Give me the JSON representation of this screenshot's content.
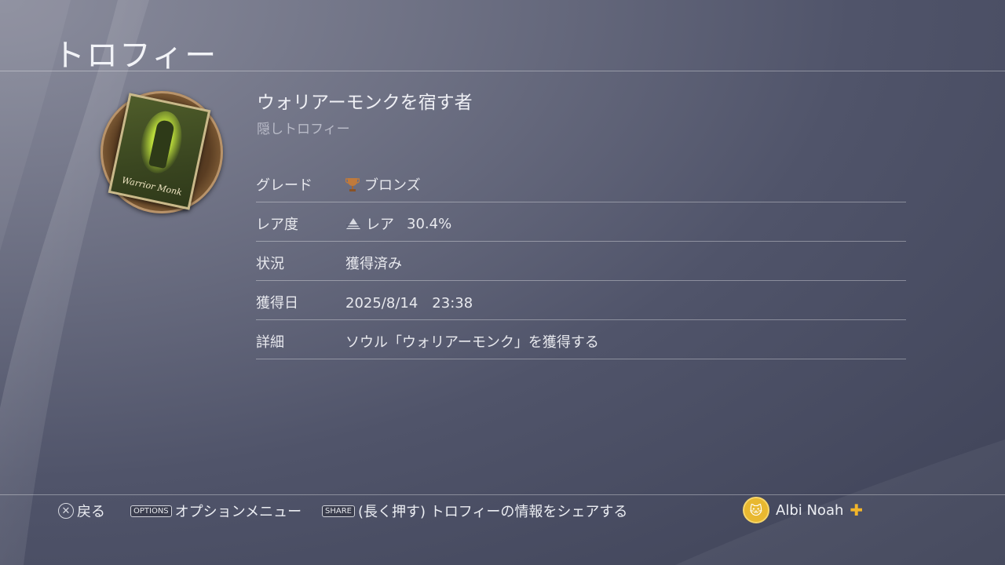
{
  "header": {
    "title": "トロフィー"
  },
  "trophy": {
    "name": "ウォリアーモンクを宿す者",
    "subtitle": "隠しトロフィー",
    "card_text": "Warrior Monk",
    "rows": [
      {
        "label": "グレード",
        "value": "ブロンズ",
        "icon": "bronze-trophy-icon"
      },
      {
        "label": "レア度",
        "value": "レア",
        "percent": "30.4%",
        "icon": "rarity-pyramid-icon"
      },
      {
        "label": "状況",
        "value": "獲得済み"
      },
      {
        "label": "獲得日",
        "value": "2025/8/14　23:38"
      },
      {
        "label": "詳細",
        "value": "ソウル「ウォリアーモンク」を獲得する"
      }
    ]
  },
  "footer": {
    "back_label": "戻る",
    "options_key": "OPTIONS",
    "options_label": "オプションメニュー",
    "share_key": "SHARE",
    "share_label": "(長く押す) トロフィーの情報をシェアする",
    "user_name": "Albi Noah",
    "plus_symbol": "✚"
  },
  "colors": {
    "background": "#50546a",
    "bronze": "#c07a3c",
    "ps_plus": "#f2b62a"
  }
}
